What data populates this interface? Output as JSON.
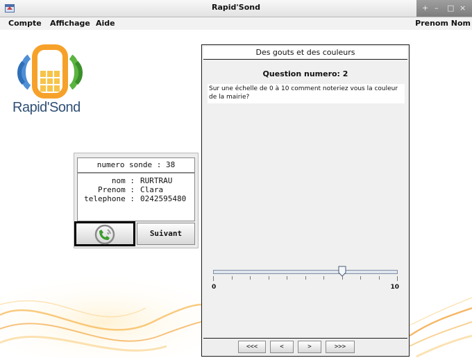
{
  "window": {
    "title": "Rapid'Sond",
    "controls": [
      "+",
      "–",
      "□",
      "×"
    ]
  },
  "menu": {
    "items": [
      "Compte",
      "Affichage",
      "Aide"
    ],
    "user": "Prenom Nom"
  },
  "branding": {
    "logo_text": "Rapid'Sond",
    "logo_icon": "phone-logo-icon"
  },
  "contact_card": {
    "sonde_label": "numero sonde :",
    "sonde_value": "38",
    "fields": [
      {
        "label": "nom :",
        "value": "RURTRAU"
      },
      {
        "label": "Prenom :",
        "value": "Clara"
      },
      {
        "label": "telephone :",
        "value": "0242595480"
      }
    ],
    "call_icon": "phone-call-icon",
    "next_label": "Suivant"
  },
  "survey": {
    "title": "Des gouts et des couleurs",
    "question_number": "Question numero: 2",
    "question_text": "Sur une échelle de 0 à 10 comment noteriez vous la couleur de la mairie?",
    "slider": {
      "min_label": "0",
      "max_label": "10",
      "min": 0,
      "max": 10,
      "value": 7,
      "ticks": 11
    },
    "nav": [
      "<<<",
      "<",
      ">",
      ">>>"
    ]
  },
  "colors": {
    "accent_orange": "#f6a12a",
    "logo_blue": "#2f4f74",
    "logo_green": "#4caf3a"
  }
}
